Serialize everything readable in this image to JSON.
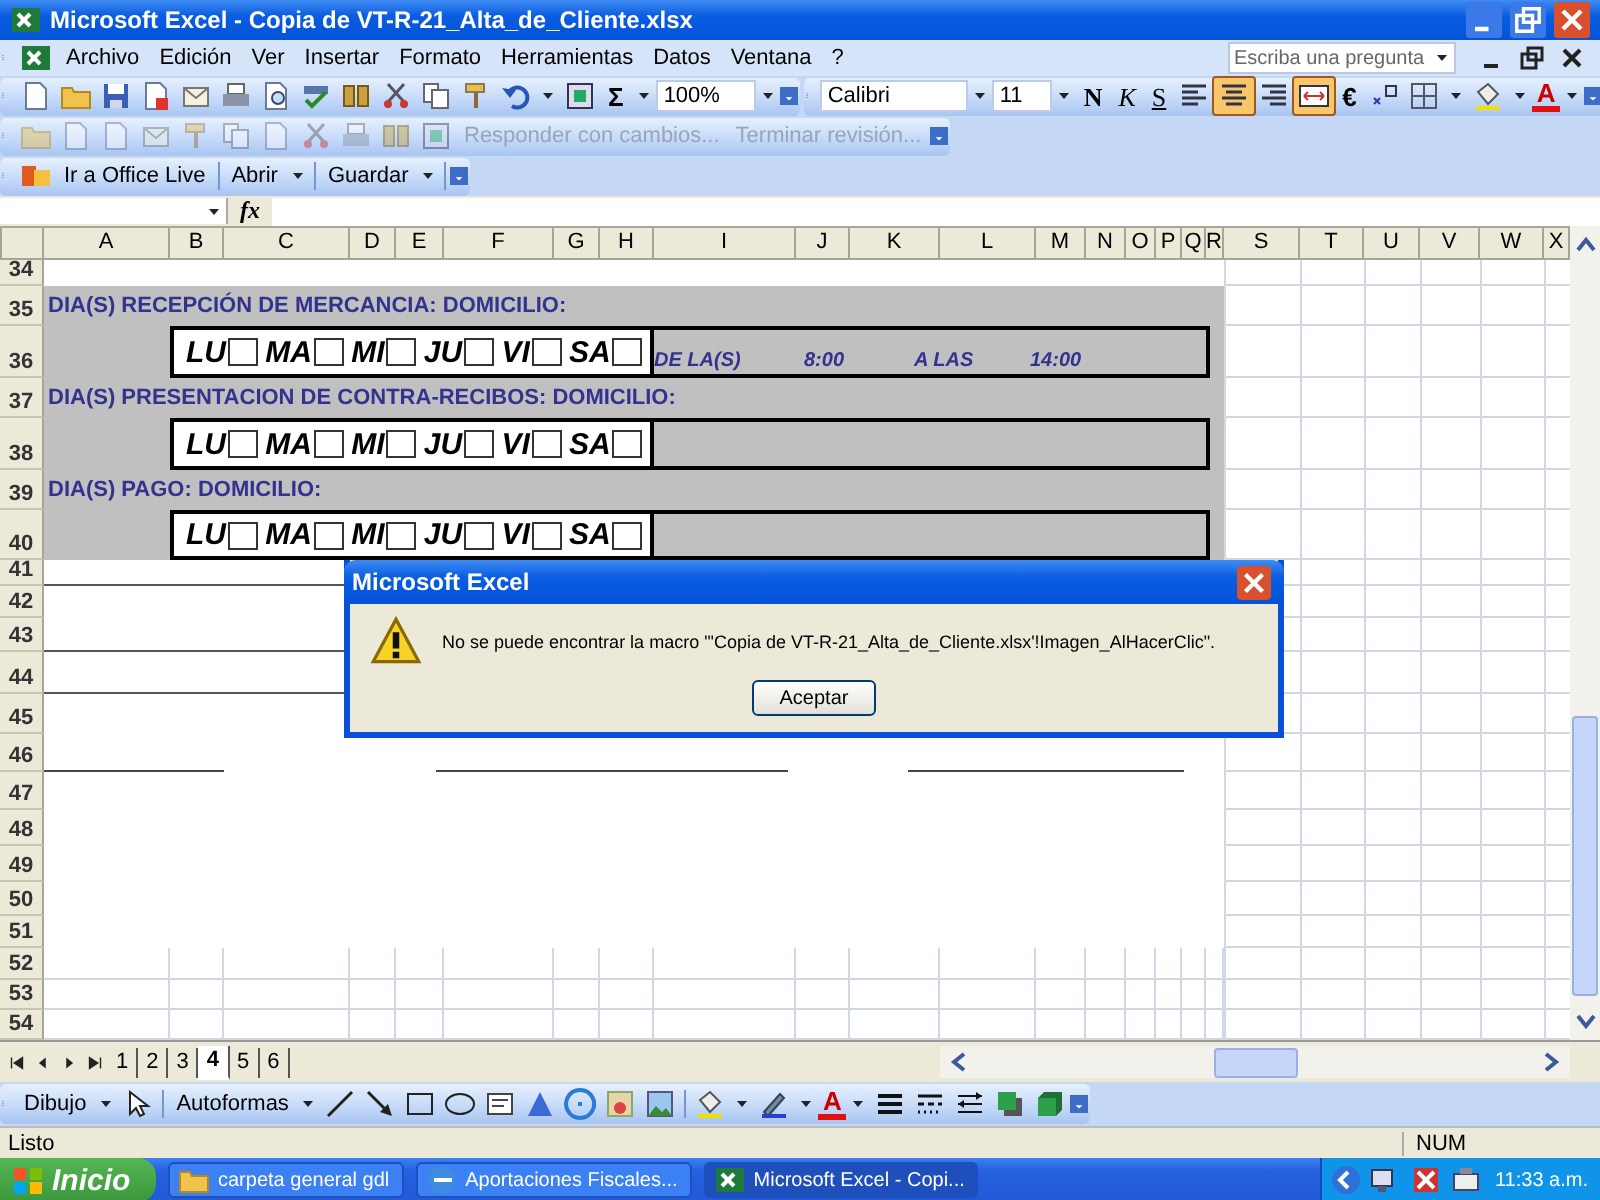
{
  "window": {
    "title": "Microsoft Excel - Copia de VT-R-21_Alta_de_Cliente.xlsx"
  },
  "menu": [
    "Archivo",
    "Edición",
    "Ver",
    "Insertar",
    "Formato",
    "Herramientas",
    "Datos",
    "Ventana",
    "?"
  ],
  "help_box": {
    "placeholder": "Escriba una pregunta"
  },
  "standard_toolbar": {
    "sum": "Σ",
    "zoom": "100%"
  },
  "format_toolbar": {
    "font": "Calibri",
    "size": "11",
    "currency": "€",
    "font_color": "A",
    "styles": [
      {
        "label": "N",
        "on": false
      },
      {
        "label": "K",
        "on": false
      },
      {
        "label": "S",
        "on": false
      }
    ],
    "alignments": [
      {
        "kind": "left",
        "on": false
      },
      {
        "kind": "center",
        "on": true
      },
      {
        "kind": "right",
        "on": false
      },
      {
        "kind": "merge",
        "on": true
      }
    ]
  },
  "review_toolbar": {
    "items": [
      {
        "label": "Responder con cambios...",
        "disabled": true
      },
      {
        "label": "Terminar revisión...",
        "disabled": true
      }
    ]
  },
  "web_toolbar": {
    "items": [
      {
        "label": "Ir a Office Live",
        "kind": "link"
      },
      {
        "label": "Abrir",
        "kind": "menu"
      },
      {
        "label": "Guardar",
        "kind": "menu"
      }
    ]
  },
  "formula_bar": {
    "fx": "fx"
  },
  "sheet": {
    "columns": [
      "A",
      "B",
      "C",
      "D",
      "E",
      "F",
      "G",
      "H",
      "I",
      "J",
      "K",
      "L",
      "M",
      "N",
      "O",
      "P",
      "Q",
      "R",
      "S",
      "T",
      "U",
      "V",
      "W",
      "X"
    ],
    "rows": [
      {
        "number": "34",
        "kind": "blank"
      },
      {
        "number": "35",
        "kind": "label",
        "text": "DIA(S) RECEPCIÓN DE MERCANCIA: DOMICILIO:"
      },
      {
        "number": "36",
        "kind": "days",
        "days": [
          {
            "label": "LU",
            "checked": false
          },
          {
            "label": "MA",
            "checked": false
          },
          {
            "label": "MI",
            "checked": false
          },
          {
            "label": "JU",
            "checked": false
          },
          {
            "label": "VI",
            "checked": false
          },
          {
            "label": "SA",
            "checked": false
          }
        ],
        "extras": [
          "DE LA(S)",
          "8:00",
          "A LAS",
          "14:00"
        ]
      },
      {
        "number": "37",
        "kind": "label",
        "text": "DIA(S) PRESENTACION DE CONTRA-RECIBOS: DOMICILIO:"
      },
      {
        "number": "38",
        "kind": "days",
        "days": [
          {
            "label": "LU",
            "checked": false
          },
          {
            "label": "MA",
            "checked": false
          },
          {
            "label": "MI",
            "checked": false
          },
          {
            "label": "JU",
            "checked": false
          },
          {
            "label": "VI",
            "checked": false
          },
          {
            "label": "SA",
            "checked": false
          }
        ]
      },
      {
        "number": "39",
        "kind": "label",
        "text": "DIA(S) PAGO: DOMICILIO:"
      },
      {
        "number": "40",
        "kind": "days",
        "days": [
          {
            "label": "LU",
            "checked": false
          },
          {
            "label": "MA",
            "checked": false
          },
          {
            "label": "MI",
            "checked": false
          },
          {
            "label": "JU",
            "checked": false
          },
          {
            "label": "VI",
            "checked": false
          },
          {
            "label": "SA",
            "checked": false
          }
        ]
      },
      {
        "number": "41",
        "kind": "ruled"
      },
      {
        "number": "42",
        "kind": "blank"
      },
      {
        "number": "43",
        "kind": "ruled"
      },
      {
        "number": "44",
        "kind": "ruled"
      },
      {
        "number": "45",
        "kind": "blank"
      },
      {
        "number": "46",
        "kind": "signature"
      },
      {
        "number": "47",
        "kind": "blank"
      },
      {
        "number": "48",
        "kind": "blank"
      },
      {
        "number": "49",
        "kind": "blank"
      },
      {
        "number": "50",
        "kind": "blank"
      },
      {
        "number": "51",
        "kind": "blank"
      },
      {
        "number": "52",
        "kind": "grid"
      },
      {
        "number": "53",
        "kind": "grid"
      },
      {
        "number": "54",
        "kind": "grid"
      }
    ]
  },
  "dialog": {
    "title": "Microsoft Excel",
    "message": "No se puede encontrar la macro \"'Copia de VT-R-21_Alta_de_Cliente.xlsx'!Imagen_AlHacerClic\".",
    "button": "Aceptar"
  },
  "sheet_tabs": [
    {
      "label": "1",
      "selected": false
    },
    {
      "label": "2",
      "selected": false
    },
    {
      "label": "3",
      "selected": false
    },
    {
      "label": "4",
      "selected": true
    },
    {
      "label": "5",
      "selected": false
    },
    {
      "label": "6",
      "selected": false
    }
  ],
  "drawing_toolbar": {
    "draw": "Dibujo",
    "autoshapes": "Autoformas",
    "font_color": "A"
  },
  "status_bar": {
    "text": "Listo",
    "num": "NUM"
  },
  "taskbar": {
    "start": "Inicio",
    "clock": "11:33 a.m.",
    "tasks": [
      {
        "label": "carpeta general gdl",
        "kind": "folder",
        "selected": false
      },
      {
        "label": "Aportaciones Fiscales...",
        "kind": "browser",
        "selected": false
      },
      {
        "label": "Microsoft Excel - Copi...",
        "kind": "excel",
        "selected": true
      }
    ]
  }
}
